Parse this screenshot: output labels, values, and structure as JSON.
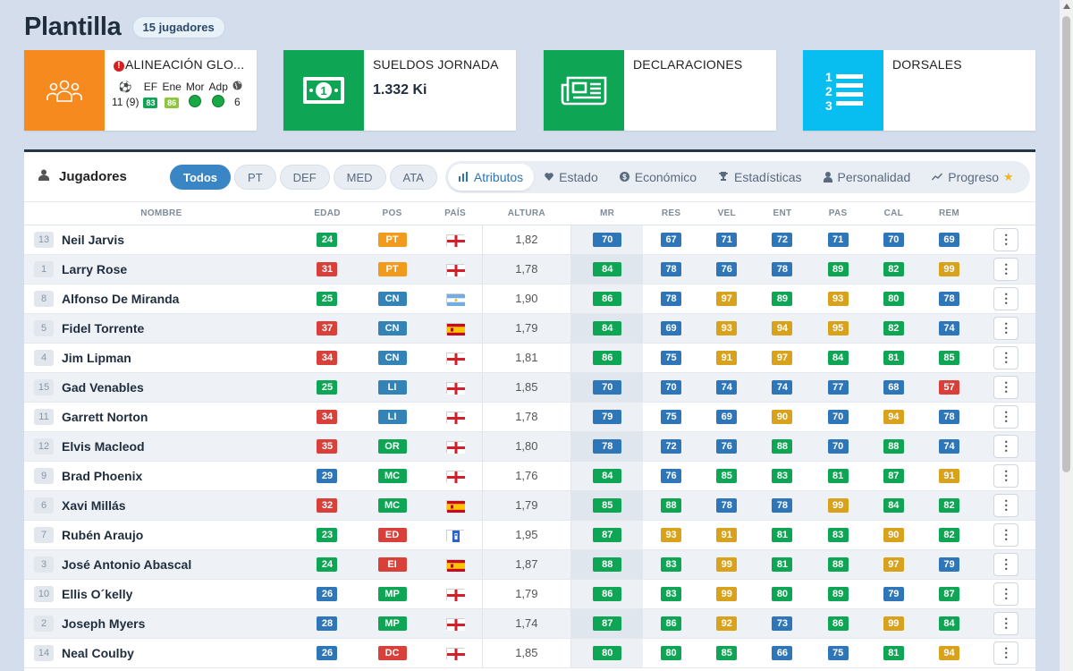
{
  "page": {
    "title": "Plantilla",
    "player_count": "15 jugadores"
  },
  "colors": {
    "orange": "#f78a1f",
    "green": "#0ea554",
    "cyan": "#08bdf0",
    "active_blue": "#3a86c4",
    "badge": {
      "green": "#0ea554",
      "blue": "#2f76b8",
      "yellow": "#d9a21c",
      "red": "#d9403a",
      "orange": "#f29a1c",
      "lime": "#8cc63f",
      "steel": "#3483b7"
    }
  },
  "cards": [
    {
      "title": "ALINEACIÓN GLO...",
      "icon": "team-icon",
      "warning": "!",
      "cols": [
        {
          "top_icon": "soccer-ball-icon",
          "bottom": "11 (9)"
        },
        {
          "top": "EF",
          "bottom_badge": "83",
          "color": "green"
        },
        {
          "top": "Ene",
          "bottom_badge": "86",
          "color": "lime"
        },
        {
          "top": "Mor",
          "bottom_icon": "green-dot-icon"
        },
        {
          "top": "Adp",
          "bottom_icon": "green-dot-icon"
        },
        {
          "top_icon": "globe-icon",
          "bottom": "6"
        }
      ]
    },
    {
      "title": "SUELDOS JORNADA",
      "value": "1.332 Ki",
      "icon": "banknote-icon"
    },
    {
      "title": "DECLARACIONES",
      "icon": "newspaper-icon"
    },
    {
      "title": "DORSALES",
      "icon": "numbered-list-icon"
    }
  ],
  "toolbar": {
    "title": "Jugadores",
    "filters": [
      "Todos",
      "PT",
      "DEF",
      "MED",
      "ATA"
    ],
    "active_filter": "Todos",
    "tabs": [
      "Atributos",
      "Estado",
      "Económico",
      "Estadísticas",
      "Personalidad",
      "Progreso"
    ],
    "active_tab": "Atributos"
  },
  "table": {
    "headers": [
      "NOMBRE",
      "EDAD",
      "POS",
      "PAÍS",
      "ALTURA",
      "MR",
      "RES",
      "VEL",
      "ENT",
      "PAS",
      "CAL",
      "REM"
    ],
    "rows": [
      {
        "dorsal": "13",
        "name": "Neil Jarvis",
        "edad": "24",
        "pos": "PT",
        "pais": "england",
        "altura": "1,82",
        "mr": "70",
        "res": "67",
        "vel": "71",
        "ent": "72",
        "pas": "71",
        "cal": "70",
        "rem": "69"
      },
      {
        "dorsal": "1",
        "name": "Larry Rose",
        "edad": "31",
        "pos": "PT",
        "pais": "england",
        "altura": "1,78",
        "mr": "84",
        "res": "78",
        "vel": "76",
        "ent": "78",
        "pas": "89",
        "cal": "82",
        "rem": "99"
      },
      {
        "dorsal": "8",
        "name": "Alfonso De Miranda",
        "edad": "25",
        "pos": "CN",
        "pais": "argentina",
        "altura": "1,90",
        "mr": "86",
        "res": "78",
        "vel": "97",
        "ent": "89",
        "pas": "93",
        "cal": "80",
        "rem": "78"
      },
      {
        "dorsal": "5",
        "name": "Fidel Torrente",
        "edad": "37",
        "pos": "CN",
        "pais": "spain",
        "altura": "1,79",
        "mr": "84",
        "res": "69",
        "vel": "93",
        "ent": "94",
        "pas": "95",
        "cal": "82",
        "rem": "74"
      },
      {
        "dorsal": "4",
        "name": "Jim Lipman",
        "edad": "34",
        "pos": "CN",
        "pais": "england",
        "altura": "1,81",
        "mr": "86",
        "res": "75",
        "vel": "91",
        "ent": "97",
        "pas": "84",
        "cal": "81",
        "rem": "85"
      },
      {
        "dorsal": "15",
        "name": "Gad Venables",
        "edad": "25",
        "pos": "LI",
        "pais": "england",
        "altura": "1,85",
        "mr": "70",
        "res": "70",
        "vel": "74",
        "ent": "74",
        "pas": "77",
        "cal": "68",
        "rem": "57"
      },
      {
        "dorsal": "11",
        "name": "Garrett Norton",
        "edad": "34",
        "pos": "LI",
        "pais": "england",
        "altura": "1,78",
        "mr": "79",
        "res": "75",
        "vel": "69",
        "ent": "90",
        "pas": "70",
        "cal": "94",
        "rem": "78"
      },
      {
        "dorsal": "12",
        "name": "Elvis Macleod",
        "edad": "35",
        "pos": "OR",
        "pais": "england",
        "altura": "1,80",
        "mr": "78",
        "res": "72",
        "vel": "76",
        "ent": "88",
        "pas": "70",
        "cal": "88",
        "rem": "74"
      },
      {
        "dorsal": "9",
        "name": "Brad Phoenix",
        "edad": "29",
        "pos": "MC",
        "pais": "england",
        "altura": "1,76",
        "mr": "84",
        "res": "76",
        "vel": "85",
        "ent": "83",
        "pas": "81",
        "cal": "87",
        "rem": "91"
      },
      {
        "dorsal": "6",
        "name": "Xavi Millás",
        "edad": "32",
        "pos": "MC",
        "pais": "spain",
        "altura": "1,79",
        "mr": "85",
        "res": "88",
        "vel": "78",
        "ent": "78",
        "pas": "99",
        "cal": "84",
        "rem": "82"
      },
      {
        "dorsal": "7",
        "name": "Rubén Araujo",
        "edad": "23",
        "pos": "ED",
        "pais": "other",
        "altura": "1,95",
        "mr": "87",
        "res": "93",
        "vel": "91",
        "ent": "81",
        "pas": "83",
        "cal": "90",
        "rem": "82"
      },
      {
        "dorsal": "3",
        "name": "José Antonio Abascal",
        "edad": "24",
        "pos": "EI",
        "pais": "spain",
        "altura": "1,87",
        "mr": "88",
        "res": "83",
        "vel": "99",
        "ent": "81",
        "pas": "88",
        "cal": "97",
        "rem": "79"
      },
      {
        "dorsal": "10",
        "name": "Ellis O´kelly",
        "edad": "26",
        "pos": "MP",
        "pais": "england",
        "altura": "1,79",
        "mr": "86",
        "res": "83",
        "vel": "99",
        "ent": "80",
        "pas": "89",
        "cal": "79",
        "rem": "87"
      },
      {
        "dorsal": "2",
        "name": "Joseph Myers",
        "edad": "28",
        "pos": "MP",
        "pais": "england",
        "altura": "1,74",
        "mr": "87",
        "res": "86",
        "vel": "92",
        "ent": "73",
        "pas": "86",
        "cal": "99",
        "rem": "84"
      },
      {
        "dorsal": "14",
        "name": "Neal Coulby",
        "edad": "26",
        "pos": "DC",
        "pais": "england",
        "altura": "1,85",
        "mr": "80",
        "res": "80",
        "vel": "85",
        "ent": "66",
        "pas": "75",
        "cal": "81",
        "rem": "94"
      }
    ]
  },
  "actions": {
    "row_menu": "⋮"
  }
}
